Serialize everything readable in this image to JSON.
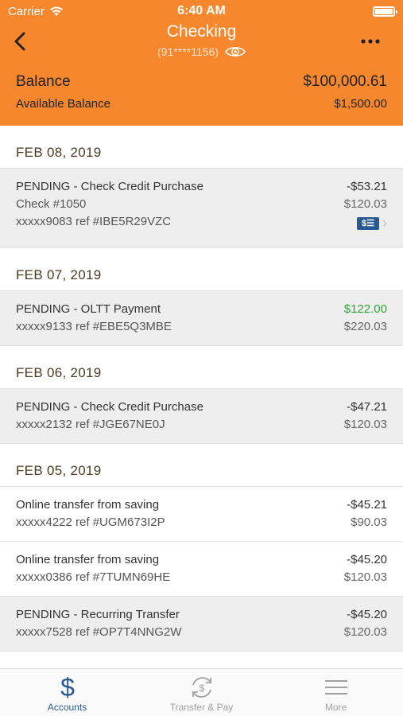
{
  "status": {
    "carrier": "Carrier",
    "time": "6:40 AM"
  },
  "nav": {
    "title": "Checking",
    "account_masked": "(91****1156)"
  },
  "balance": {
    "label": "Balance",
    "value": "$100,000.61",
    "available_label": "Available Balance",
    "available_value": "$1,500.00"
  },
  "groups": [
    {
      "date": "FEB 08, 2019",
      "items": [
        {
          "desc": "PENDING - Check Credit Purchase",
          "line2": "Check #1050",
          "line3": "xxxxx9083 ref #IBE5R29VZC",
          "amount": "-$53.21",
          "balance": "$120.03"
        }
      ]
    },
    {
      "date": "FEB 07, 2019",
      "items": [
        {
          "desc": "PENDING - OLTT Payment",
          "line2": "xxxxx9133 ref #EBE5Q3MBE",
          "amount": "$122.00",
          "balance": "$220.03"
        }
      ]
    },
    {
      "date": "FEB 06, 2019",
      "items": [
        {
          "desc": "PENDING - Check Credit Purchase",
          "line2": "xxxxx2132 ref #JGE67NE0J",
          "amount": "-$47.21",
          "balance": "$120.03"
        }
      ]
    },
    {
      "date": "FEB 05, 2019",
      "items": [
        {
          "desc": "Online transfer from saving",
          "line2": "xxxxx4222 ref #UGM673I2P",
          "amount": "-$45.21",
          "balance": "$90.03"
        },
        {
          "desc": "Online transfer from saving",
          "line2": "xxxxx0386 ref #7TUMN69HE",
          "amount": "-$45.20",
          "balance": "$120.03"
        },
        {
          "desc": "PENDING - Recurring Transfer",
          "line2": "xxxxx7528 ref #OP7T4NNG2W",
          "amount": "-$45.20",
          "balance": "$120.03"
        }
      ]
    }
  ],
  "tabs": {
    "accounts": "Accounts",
    "transfer": "Transfer & Pay",
    "more": "More"
  },
  "colors": {
    "brand_orange": "#f7872c",
    "accent_blue": "#2a5a8f",
    "positive_green": "#2ea636",
    "pending_bg": "#eeeeee"
  }
}
